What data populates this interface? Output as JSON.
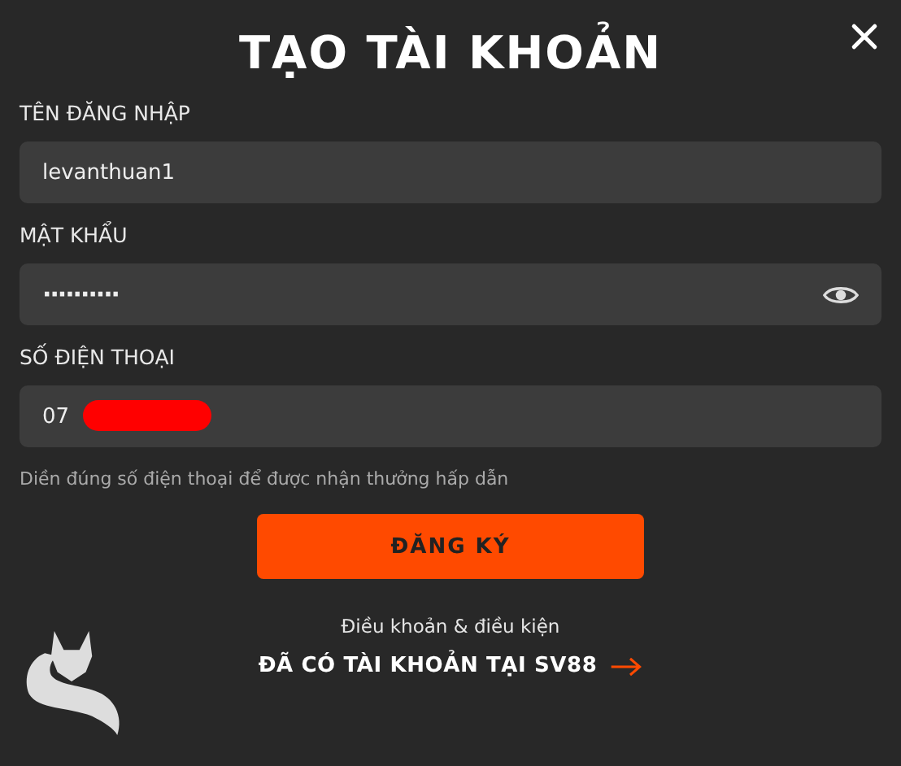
{
  "title": "TẠO TÀI KHOẢN",
  "fields": [
    {
      "label": "TÊN ĐĂNG NHẬP",
      "value": "levanthuan1",
      "kind": "text"
    },
    {
      "label": "MẬT KHẨU",
      "value": "··········",
      "kind": "password"
    },
    {
      "label": "SỐ ĐIỆN THOẠI",
      "value": "07",
      "kind": "phone",
      "redacted": true
    }
  ],
  "hint": "Diền đúng số điện thoại để được nhận thưởng hấp dẫn",
  "submit": "ĐĂNG KÝ",
  "terms_link": "Điều khoản & điều kiện",
  "login_link": "ĐÃ CÓ TÀI KHOẢN TẠI SV88"
}
